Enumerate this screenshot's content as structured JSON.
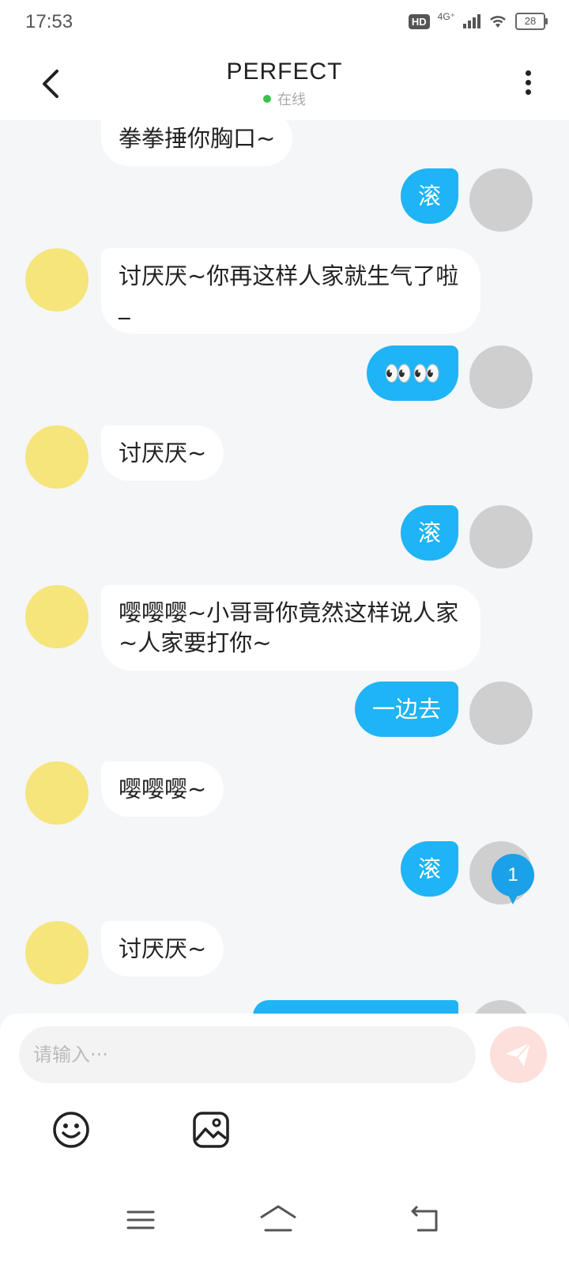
{
  "status": {
    "time": "17:53",
    "hd": "HD",
    "network": "4G⁺",
    "battery": "28"
  },
  "header": {
    "title": "PERFECT",
    "online_text": "在线",
    "online_color": "#3ac14a"
  },
  "messages": [
    {
      "side": "left",
      "text": "拳拳捶你胸口~"
    },
    {
      "side": "right",
      "text": "滚"
    },
    {
      "side": "left",
      "text": "讨厌厌~你再这样人家就生气了啦_"
    },
    {
      "side": "right",
      "text": "👀👀"
    },
    {
      "side": "left",
      "text": "讨厌厌~"
    },
    {
      "side": "right",
      "text": "滚"
    },
    {
      "side": "left",
      "text": "嘤嘤嘤~小哥哥你竟然这样说人家~人家要打你~"
    },
    {
      "side": "right",
      "text": "一边去"
    },
    {
      "side": "left",
      "text": "嘤嘤嘤~"
    },
    {
      "side": "right",
      "text": "滚"
    },
    {
      "side": "left",
      "text": "讨厌厌~"
    }
  ],
  "unread_count": "1",
  "input": {
    "placeholder": "请输入···",
    "value": ""
  },
  "icons": {
    "back": "chevron-left-icon",
    "more": "more-vertical-icon",
    "send": "send-icon",
    "emoji": "smile-icon",
    "image": "image-icon",
    "nav_menu": "menu-icon",
    "nav_home": "home-icon",
    "nav_back": "back-arrow-icon"
  },
  "colors": {
    "accent": "#1eb4f5",
    "background": "#f4f6f8",
    "send_button": "#fde0dc"
  }
}
